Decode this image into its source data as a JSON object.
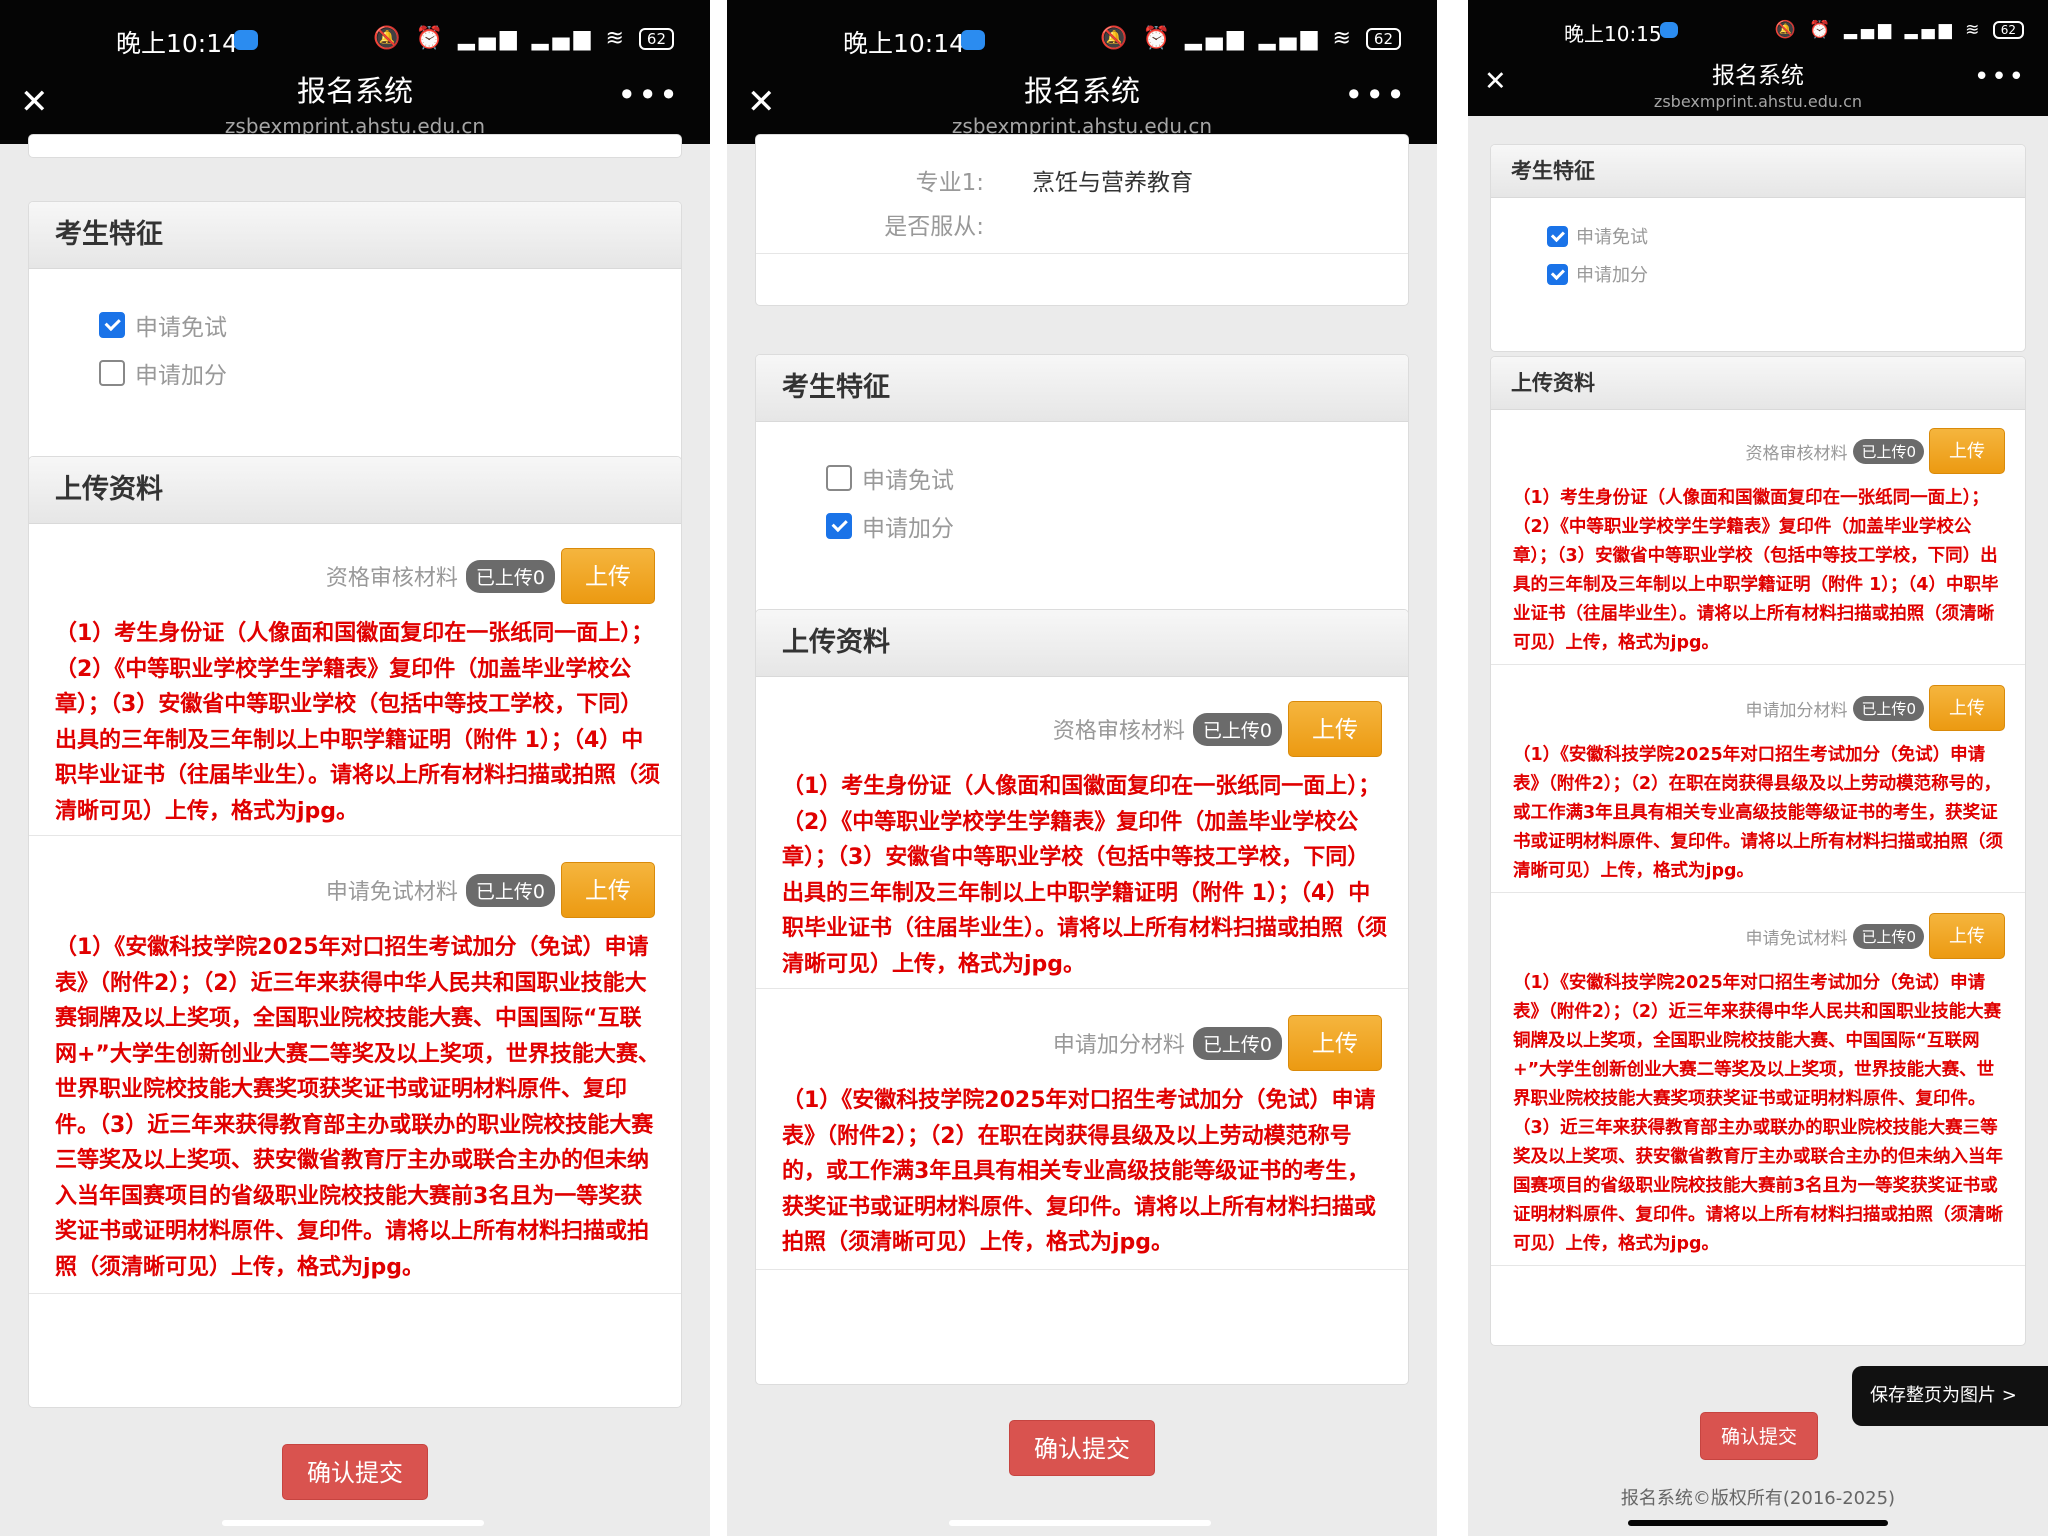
{
  "status": {
    "p1_time": "晚上10:14",
    "p2_time": "晚上10:14",
    "p3_time": "晚上10:15",
    "battery": "62"
  },
  "nav": {
    "title": "报名系统",
    "url": "zsbexmprint.ahstu.edu.cn"
  },
  "features": {
    "heading": "考生特征",
    "exempt_label": "申请免试",
    "bonus_label": "申请加分"
  },
  "upload": {
    "heading": "上传资料",
    "badge": "已上传0",
    "upload_btn": "上传",
    "qual_label": "资格审核材料",
    "exempt_label": "申请免试材料",
    "bonus_label": "申请加分材料",
    "qual_desc": "（1）考生身份证（人像面和国徽面复印在一张纸同一面上）；（2）《中等职业学校学生学籍表》复印件（加盖毕业学校公章）；（3）安徽省中等职业学校（包括中等技工学校，下同）出具的三年制及三年制以上中职学籍证明（附件 1）；（4）中职毕业证书（往届毕业生）。请将以上所有材料扫描或拍照（须清晰可见）上传，格式为jpg。",
    "exempt_desc": "（1）《安徽科技学院2025年对口招生考试加分（免试）申请表》（附件2）；（2）近三年来获得中华人民共和国职业技能大赛铜牌及以上奖项，全国职业院校技能大赛、中国国际“互联网+”大学生创新创业大赛二等奖及以上奖项，世界技能大赛、世界职业院校技能大赛奖项获奖证书或证明材料原件、复印件。（3）近三年来获得教育部主办或联办的职业院校技能大赛三等奖及以上奖项、获安徽省教育厅主办或联合主办的但未纳入当年国赛项目的省级职业院校技能大赛前3名且为一等奖获奖证书或证明材料原件、复印件。请将以上所有材料扫描或拍照（须清晰可见）上传，格式为jpg。",
    "bonus_desc": "（1）《安徽科技学院2025年对口招生考试加分（免试）申请表》（附件2）；（2）在职在岗获得县级及以上劳动模范称号的，或工作满3年且具有相关专业高级技能等级证书的考生，获奖证书或证明材料原件、复印件。请将以上所有材料扫描或拍照（须清晰可见）上传，格式为jpg。"
  },
  "major": {
    "major1_label": "专业1:",
    "major1_value": "烹饪与营养教育",
    "obey_label": "是否服从:"
  },
  "submit_label": "确认提交",
  "save_page_label": "保存整页为图片 >",
  "footer": "报名系统©版权所有(2016-2025)"
}
